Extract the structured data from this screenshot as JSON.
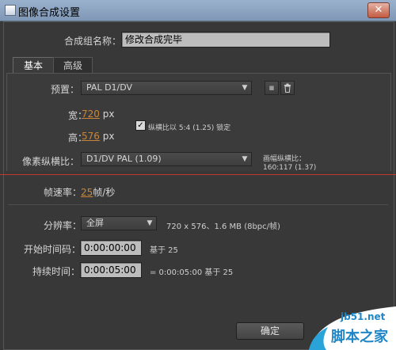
{
  "window": {
    "title": "图像合成设置",
    "close_glyph": "✕"
  },
  "comp_name": {
    "label": "合成组名称：",
    "value": "修改合成完毕"
  },
  "tabs": [
    {
      "label": "基本"
    },
    {
      "label": "高级"
    }
  ],
  "preset": {
    "label": "预置：",
    "value": "PAL D1/DV"
  },
  "width": {
    "label": "宽：",
    "value": "720",
    "unit": "px"
  },
  "height": {
    "label": "高：",
    "value": "576",
    "unit": "px"
  },
  "lock_aspect": {
    "checked": true,
    "label": "纵横比以 5:4 (1.25) 锁定"
  },
  "pixel_aspect": {
    "label": "像素纵横比：",
    "value": "D1/DV PAL (1.09)"
  },
  "frame_aspect": {
    "label": "画幅纵横比：",
    "value": "160:117 (1.37)"
  },
  "frame_rate": {
    "label": "帧速率：",
    "value": "25",
    "unit": "帧/秒"
  },
  "resolution": {
    "label": "分辨率：",
    "value": "全屏",
    "info": "720 x 576、1.6 MB (8bpc/帧)"
  },
  "start_timecode": {
    "label": "开始时间码：",
    "value": "0:00:00:00",
    "note": "基于 25"
  },
  "duration": {
    "label": "持续时间：",
    "value": "0:00:05:00",
    "note": "= 0:00:05:00  基于 25"
  },
  "buttons": {
    "ok": "确定"
  },
  "watermark": {
    "site": "jb51.net",
    "text": "脚本之家"
  },
  "colors": {
    "titlebar": "#8aa3c0",
    "link": "#c8863a",
    "guide_line": "#c0392b"
  }
}
